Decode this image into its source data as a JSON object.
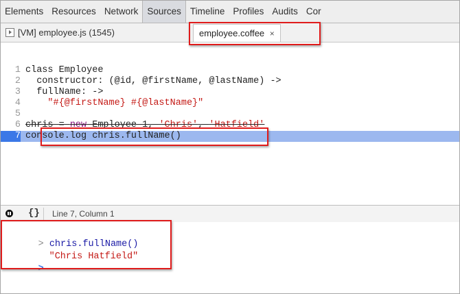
{
  "toolbar": {
    "tabs": [
      "Elements",
      "Resources",
      "Network",
      "Sources",
      "Timeline",
      "Profiles",
      "Audits",
      "Cor"
    ],
    "active_tab": "Sources"
  },
  "file_tabs": {
    "vm_tab": "[VM] employee.js (1545)",
    "active_tab": "employee.coffee",
    "close_glyph": "×"
  },
  "editor": {
    "line_numbers": [
      "1",
      "2",
      "3",
      "4",
      "5",
      "6",
      "7"
    ],
    "code": {
      "l1": "class Employee",
      "l2": "  constructor: (@id, @firstName, @lastName) ->",
      "l3": "  fullName: ->",
      "l4_str": "\"#{@firstName} #{@lastName}\"",
      "l6_a": "chris = ",
      "l6_kw": "new",
      "l6_b": " Employee 1, ",
      "l6_s1": "'Chris'",
      "l6_c": ", ",
      "l6_s2": "'Hatfield'",
      "l7": "console.log chris.fullName()"
    },
    "highlighted_line": "7"
  },
  "statusbar": {
    "pause_icon": "pause-on-exceptions-icon",
    "pretty_print": "{}",
    "position": "Line 7, Column 1"
  },
  "console": {
    "prompt": ">",
    "command": "chris.fullName()",
    "result": "\"Chris Hatfield\"",
    "input_caret": ">"
  },
  "colors": {
    "annotation": "#e01b1b",
    "highlight_line": "#9cb8ef",
    "keyword": "#881280",
    "string": "#c41a16",
    "console_command": "#1a1aa6"
  }
}
